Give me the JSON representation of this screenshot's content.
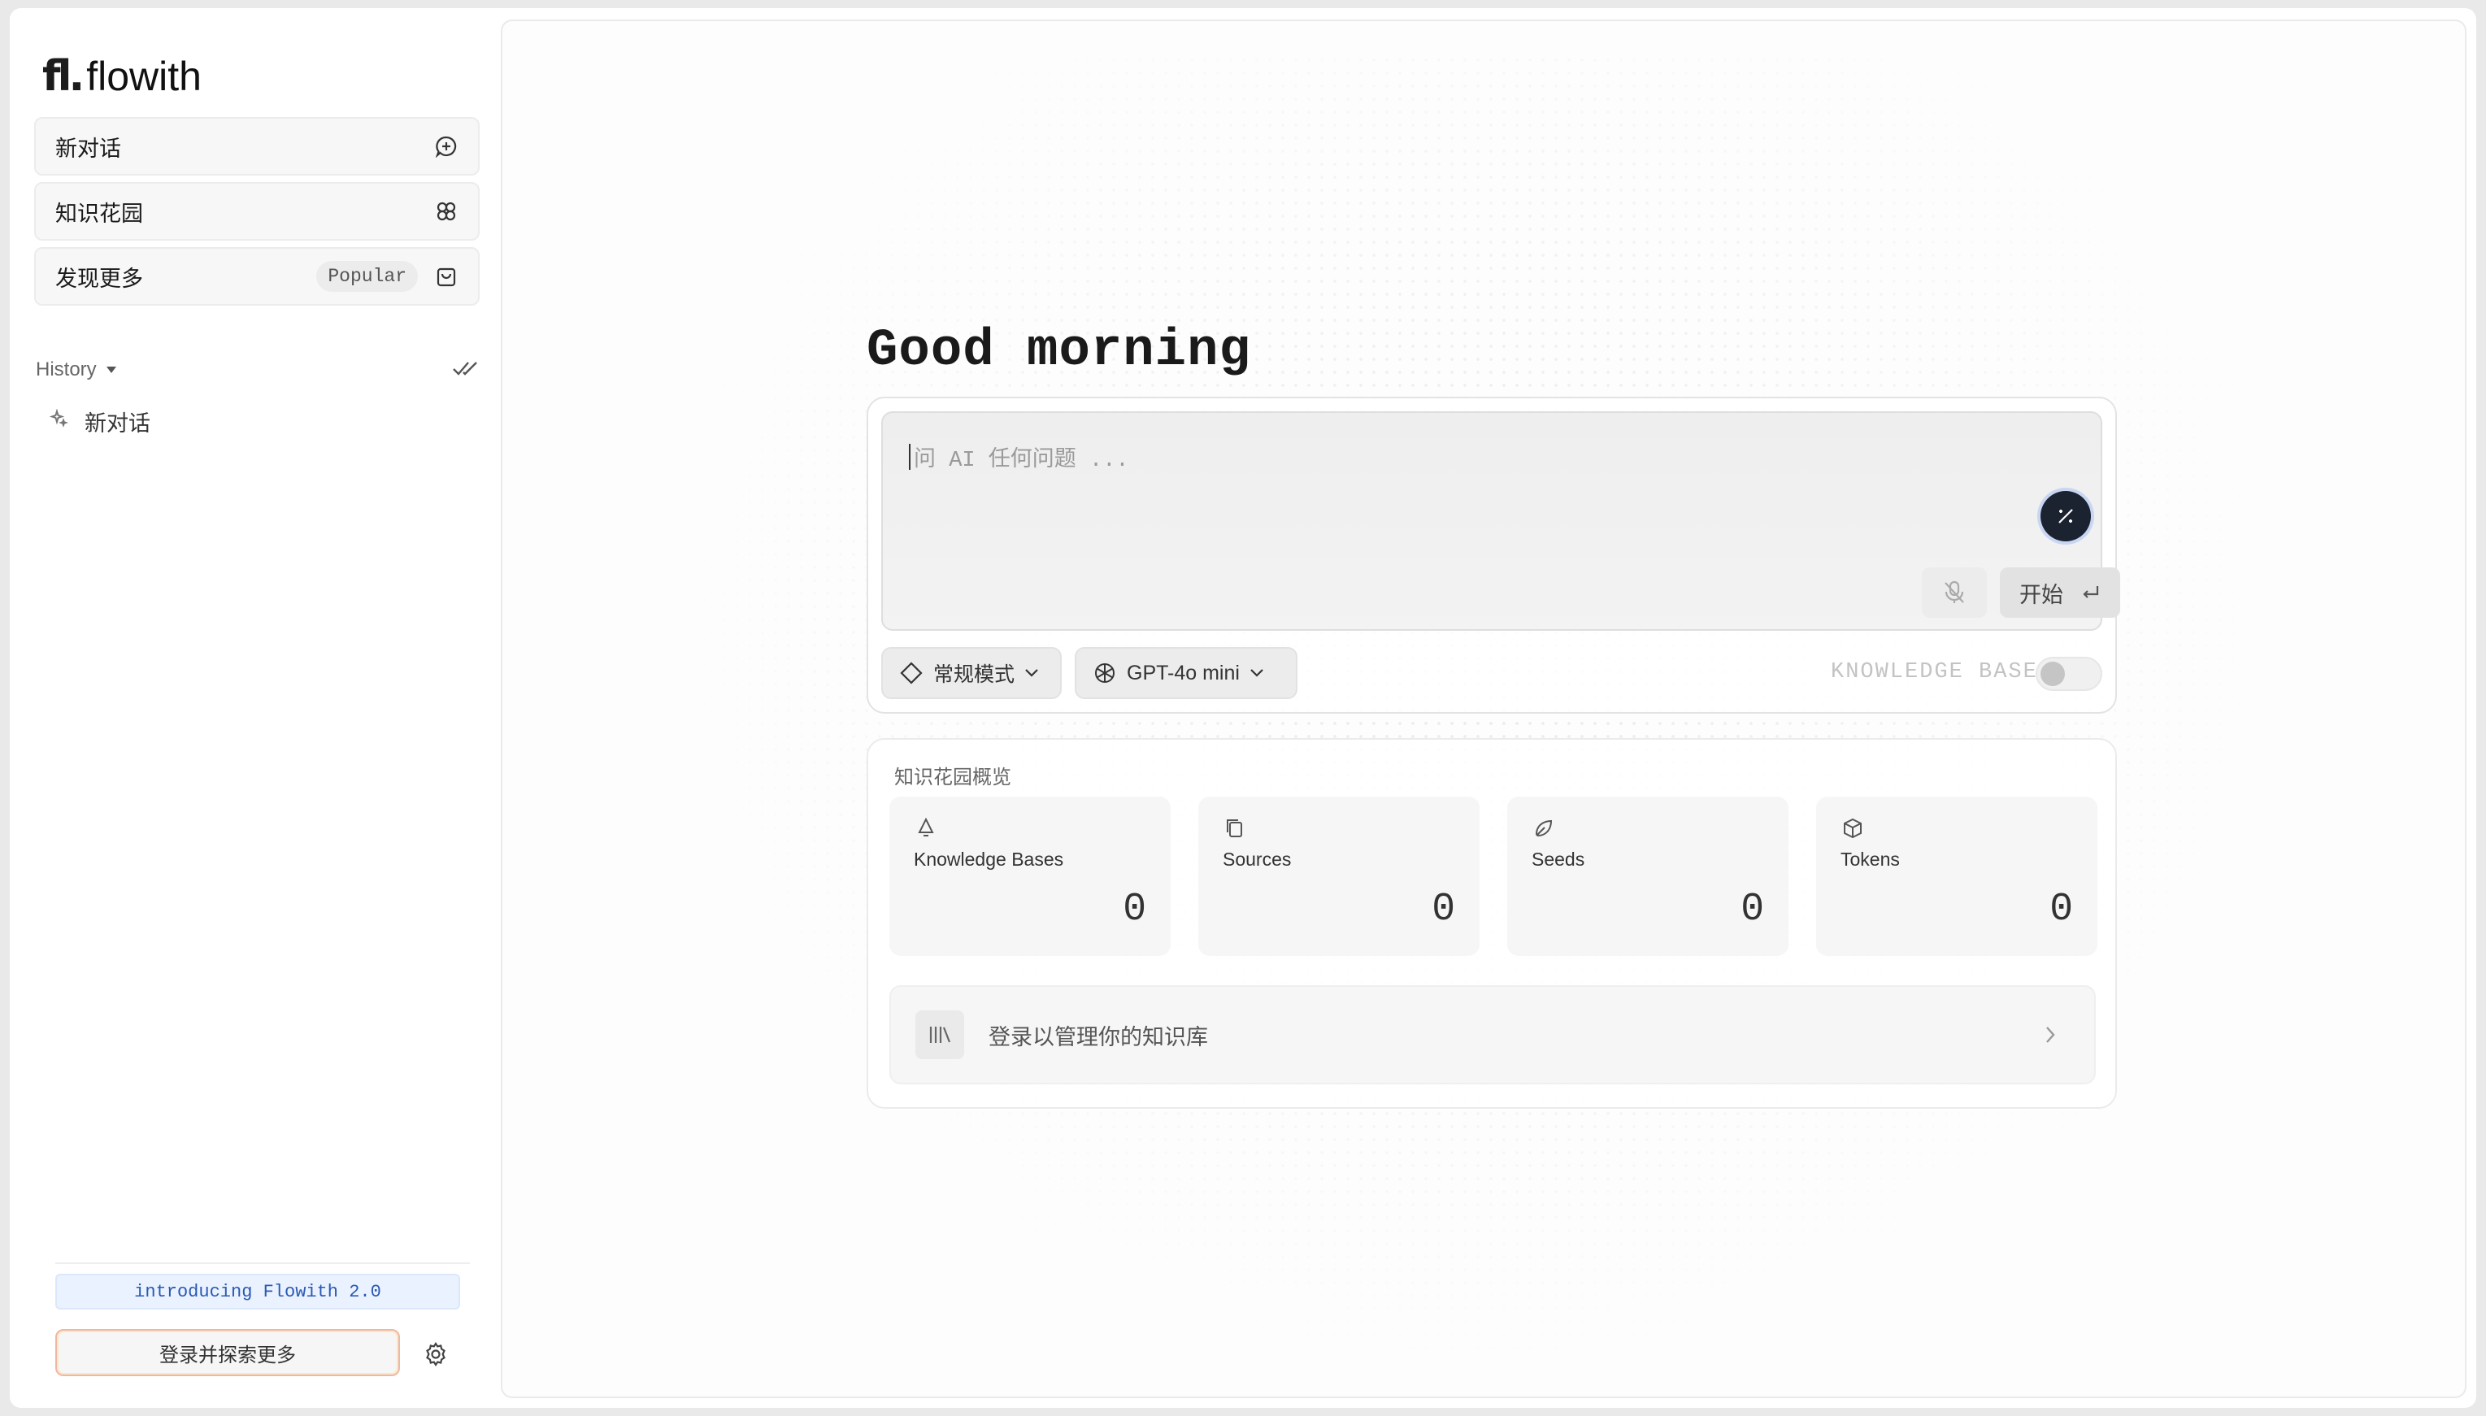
{
  "app": {
    "logo_mark": "fl.",
    "logo_text": "flowith"
  },
  "sidebar": {
    "items": [
      {
        "label": "新对话",
        "icon": "chat-plus-icon"
      },
      {
        "label": "知识花园",
        "icon": "clover-icon"
      },
      {
        "label": "发现更多",
        "icon": "shopping-bag-icon",
        "badge": "Popular"
      }
    ],
    "history_title": "History",
    "history_items": [
      {
        "label": "新对话",
        "icon": "sparkle-icon"
      }
    ],
    "intro_banner": "introducing Flowith 2.0",
    "login_button": "登录并探索更多"
  },
  "main": {
    "greeting": "Good morning",
    "input_placeholder": "问 AI 任何问题 ...",
    "start_button": "开始",
    "mode_select": "常规模式",
    "model_select": "GPT-4o mini",
    "knowledge_base_label": "KNOWLEDGE BASE",
    "knowledge_base_enabled": false,
    "garden": {
      "title": "知识花园概览",
      "stats": [
        {
          "label": "Knowledge Bases",
          "value": "0",
          "icon": "bell-shape-icon"
        },
        {
          "label": "Sources",
          "value": "0",
          "icon": "copy-icon"
        },
        {
          "label": "Seeds",
          "value": "0",
          "icon": "seed-icon"
        },
        {
          "label": "Tokens",
          "value": "0",
          "icon": "cube-icon"
        }
      ],
      "login_manage": "登录以管理你的知识库"
    }
  },
  "colors": {
    "accent_dark": "#1b2330",
    "banner_text": "#2a59b3",
    "banner_bg": "#eaf2ff",
    "login_border": "#f0b7a6"
  }
}
